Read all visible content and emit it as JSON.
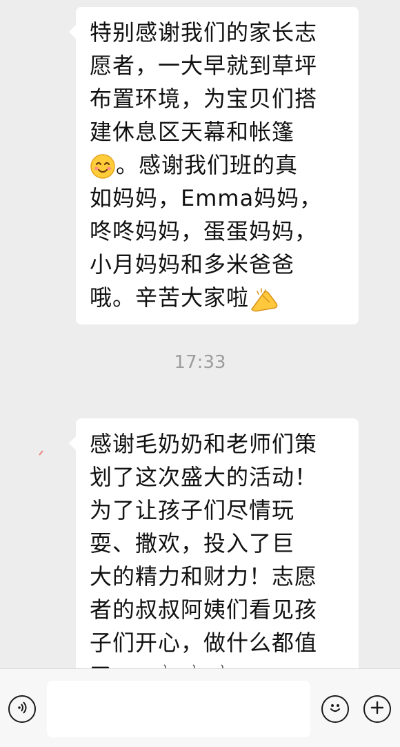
{
  "messages": [
    {
      "lines": [
        "特别感谢我们的家长志",
        "愿者，一大早就到草坪",
        "布置环境，为宝贝们搭",
        "建休息区天幕和帐篷",
        "。感谢我们班的真",
        "如妈妈，Emma妈妈，",
        "咚咚妈妈，蛋蛋妈妈，",
        "小月妈妈和多米爸爸",
        "哦。辛苦大家啦"
      ],
      "emoji": [
        "smiling-face",
        "clasped-hands"
      ]
    },
    {
      "lines": [
        "感谢毛奶奶和老师们策",
        "划了这次盛大的活动！",
        "为了让孩子们尽情玩",
        "耍、撒欢，投入了巨",
        "大的精力和财力！志愿",
        "者的叔叔阿姨们看见孩",
        "子们开心，做什么都值",
        "了"
      ],
      "emoji": [
        "celebration",
        "firecracker",
        "firecracker",
        "firecracker"
      ]
    }
  ],
  "timestamp": "17:33",
  "input": {
    "value": ""
  },
  "colors": {
    "background": "#ededed",
    "bubble": "#ffffff",
    "text": "#111111",
    "timestamp": "#9c9c9c"
  }
}
